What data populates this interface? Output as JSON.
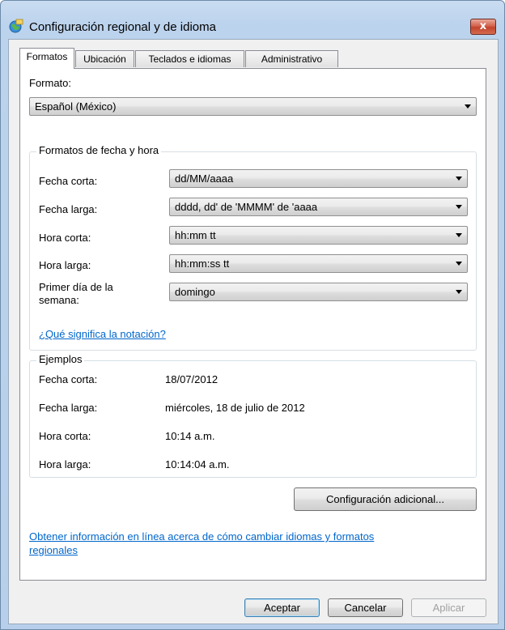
{
  "window": {
    "title": "Configuración regional y de idioma",
    "close_label": "x"
  },
  "tabs": [
    {
      "label": "Formatos"
    },
    {
      "label": "Ubicación"
    },
    {
      "label": "Teclados e idiomas"
    },
    {
      "label": "Administrativo"
    }
  ],
  "format": {
    "label": "Formato:",
    "value": "Español (México)"
  },
  "date_time": {
    "title": "Formatos de fecha y hora",
    "rows": [
      {
        "label": "Fecha corta:",
        "value": "dd/MM/aaaa"
      },
      {
        "label": "Fecha larga:",
        "value": "dddd, dd' de 'MMMM' de 'aaaa"
      },
      {
        "label": "Hora corta:",
        "value": "hh:mm tt"
      },
      {
        "label": "Hora larga:",
        "value": "hh:mm:ss tt"
      },
      {
        "label_line1": "Primer día de la",
        "label_line2": "semana:",
        "value": "domingo"
      }
    ],
    "notation_link": "¿Qué significa la notación?"
  },
  "examples": {
    "title": "Ejemplos",
    "rows": [
      {
        "label": "Fecha corta:",
        "value": "18/07/2012"
      },
      {
        "label": "Fecha larga:",
        "value": "miércoles, 18 de julio de 2012"
      },
      {
        "label": "Hora corta:",
        "value": "10:14 a.m."
      },
      {
        "label": "Hora larga:",
        "value": "10:14:04 a.m."
      }
    ]
  },
  "additional_button": "Configuración adicional...",
  "online_link": {
    "line1": "Obtener información en línea acerca de cómo cambiar idiomas y formatos",
    "line2": "regionales"
  },
  "footer": {
    "ok": "Aceptar",
    "cancel": "Cancelar",
    "apply": "Aplicar"
  }
}
